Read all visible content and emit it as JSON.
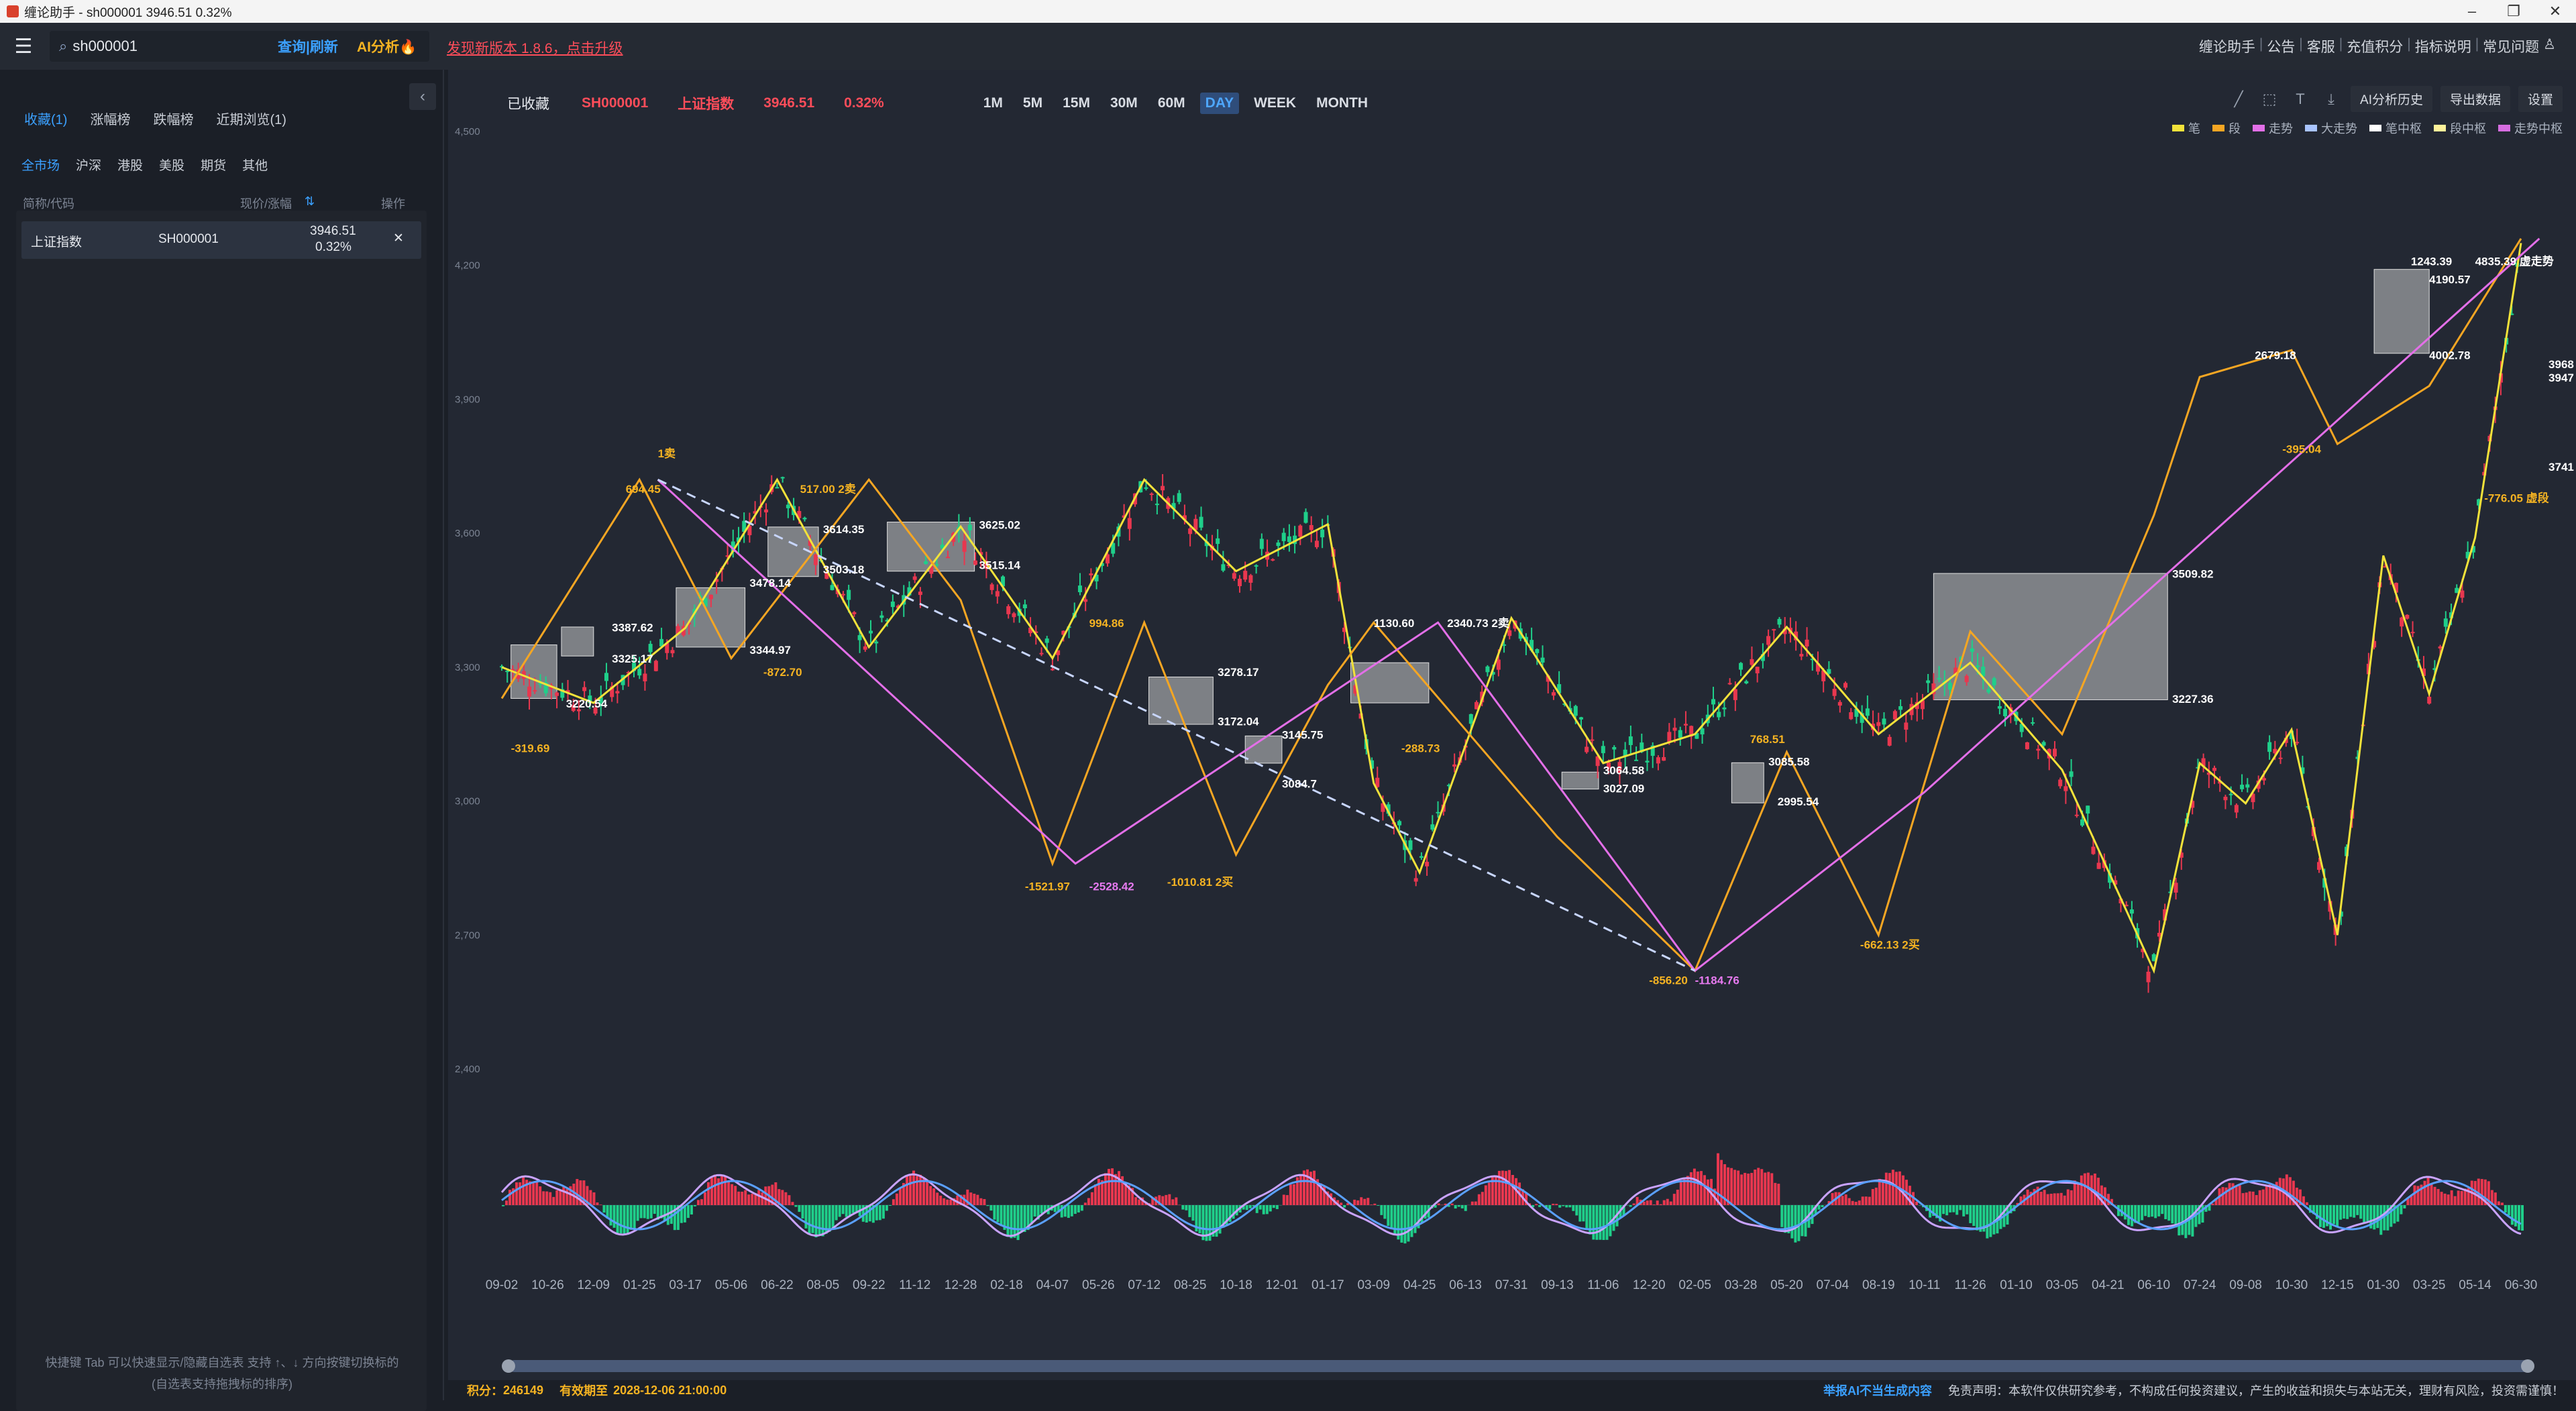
{
  "window": {
    "title": "缠论助手 - sh000001 3946.51 0.32%"
  },
  "topbar": {
    "search_value": "sh000001",
    "query_label": "查询|刷新",
    "ai_label": "AI分析🔥",
    "upgrade_text": "发现新版本 1.8.6，点击升级",
    "links": [
      "缠论助手",
      "公告",
      "客服",
      "充值积分",
      "指标说明",
      "常见问题"
    ]
  },
  "sidebar": {
    "tabs": [
      "收藏(1)",
      "涨幅榜",
      "跌幅榜",
      "近期浏览(1)"
    ],
    "markets": [
      "全市场",
      "沪深",
      "港股",
      "美股",
      "期货",
      "其他"
    ],
    "headers": {
      "name": "简称/代码",
      "price": "现价/涨幅",
      "action": "操作"
    },
    "rows": [
      {
        "name": "上证指数",
        "code": "SH000001",
        "price": "3946.51",
        "change": "0.32%"
      }
    ],
    "hint1": "快捷键 Tab 可以快速显示/隐藏自选表 支持 ↑、↓ 方向按键切换标的",
    "hint2": "(自选表支持拖拽标的排序)"
  },
  "chartbar": {
    "fav": "已收藏",
    "code": "SH000001",
    "name": "上证指数",
    "price": "3946.51",
    "pct": "0.32%"
  },
  "periods": [
    "1M",
    "5M",
    "15M",
    "30M",
    "60M",
    "DAY",
    "WEEK",
    "MONTH"
  ],
  "active_period": "DAY",
  "tools": {
    "ai_history": "AI分析历史",
    "export": "导出数据",
    "settings": "设置"
  },
  "legend": [
    {
      "label": "笔",
      "color": "#f2e23a"
    },
    {
      "label": "段",
      "color": "#f5a623"
    },
    {
      "label": "走势",
      "color": "#e36fe8"
    },
    {
      "label": "大走势",
      "color": "#a9c4ff"
    },
    {
      "label": "笔中枢",
      "color": "#ffffff"
    },
    {
      "label": "段中枢",
      "color": "#fff29a"
    },
    {
      "label": "走势中枢",
      "color": "#d66de0"
    }
  ],
  "status": {
    "points_label": "积分：",
    "points": "246149",
    "expiry_label": "有效期至",
    "expiry": "2028-12-06 21:00:00",
    "report": "举报AI不当生成内容",
    "disclaimer": "免责声明：本软件仅供研究参考，不构成任何投资建议，产生的收益和损失与本站无关，理财有风险，投资需谨慎！"
  },
  "chart_data": {
    "type": "line",
    "title": "",
    "y_ticks": [
      2400,
      2700,
      3000,
      3300,
      3600,
      3900,
      4200,
      4500
    ],
    "ylim": [
      2400,
      4500
    ],
    "x_labels": [
      "09-02",
      "10-26",
      "12-09",
      "01-25",
      "03-17",
      "05-06",
      "06-22",
      "08-05",
      "09-22",
      "11-12",
      "12-28",
      "02-18",
      "04-07",
      "05-26",
      "07-12",
      "08-25",
      "10-18",
      "12-01",
      "01-17",
      "03-09",
      "04-25",
      "06-13",
      "07-31",
      "09-13",
      "11-06",
      "12-20",
      "02-05",
      "03-28",
      "05-20",
      "07-04",
      "08-19",
      "10-11",
      "11-26",
      "01-10",
      "03-05",
      "04-21",
      "06-10",
      "07-24",
      "09-08",
      "10-30",
      "12-15",
      "01-30",
      "03-25",
      "05-14",
      "06-30"
    ],
    "series": [
      {
        "name": "笔",
        "x": [
          0,
          2,
          4,
          6,
          8,
          10,
          12,
          14,
          16,
          18,
          19,
          20,
          22,
          24,
          26,
          28,
          30,
          32,
          34,
          36,
          37,
          38,
          39,
          40,
          41,
          42,
          43,
          44
        ],
        "values": [
          3300,
          3220,
          3388,
          3720,
          3345,
          3615,
          3320,
          3720,
          3515,
          3620,
          3040,
          2840,
          3410,
          3085,
          3150,
          3390,
          3150,
          3310,
          3070,
          2620,
          3085,
          2995,
          3160,
          2700,
          3550,
          3240,
          3590,
          4250
        ]
      },
      {
        "name": "段",
        "x": [
          0,
          3,
          5,
          8,
          10,
          12,
          14,
          16,
          18,
          19,
          21,
          23,
          26,
          28,
          30,
          32,
          34,
          36,
          37,
          39,
          40,
          42,
          44
        ],
        "values": [
          3230,
          3720,
          3320,
          3720,
          3450,
          2860,
          3400,
          2880,
          3260,
          3400,
          3160,
          2920,
          2620,
          3110,
          2700,
          3380,
          3150,
          3640,
          3950,
          4010,
          3800,
          3930,
          4260
        ]
      },
      {
        "name": "走势",
        "x": [
          3.4,
          12.5,
          20.4,
          26.0,
          31.0,
          44.4
        ],
        "values": [
          3720,
          2860,
          3400,
          2620,
          3020,
          4260
        ]
      },
      {
        "name": "大走势",
        "x": [
          3.4,
          26.0
        ],
        "values": [
          3720,
          2620
        ]
      }
    ],
    "price_labels": [
      {
        "text": "694.45",
        "x": 2.7,
        "y": 3690
      },
      {
        "text": "1卖",
        "x": 3.4,
        "y": 3770
      },
      {
        "text": "-319.69",
        "x": 0.2,
        "y": 3110
      },
      {
        "text": "3220.54",
        "x": 1.4,
        "y": 3210
      },
      {
        "text": "3325.17",
        "x": 2.4,
        "y": 3310
      },
      {
        "text": "3387.62",
        "x": 2.4,
        "y": 3380
      },
      {
        "text": "3344.97",
        "x": 5.4,
        "y": 3330
      },
      {
        "text": "-872.70",
        "x": 5.7,
        "y": 3280
      },
      {
        "text": "3478.14",
        "x": 5.4,
        "y": 3480
      },
      {
        "text": "3614.35",
        "x": 7.0,
        "y": 3600
      },
      {
        "text": "3503.18",
        "x": 7.0,
        "y": 3510
      },
      {
        "text": "517.00 2卖",
        "x": 6.5,
        "y": 3690
      },
      {
        "text": "3625.02",
        "x": 10.4,
        "y": 3610
      },
      {
        "text": "3515.14",
        "x": 10.4,
        "y": 3520
      },
      {
        "text": "-1521.97",
        "x": 11.4,
        "y": 2800
      },
      {
        "text": "-2528.42",
        "x": 12.8,
        "y": 2800
      },
      {
        "text": "994.86",
        "x": 12.8,
        "y": 3390
      },
      {
        "text": "3278.17",
        "x": 15.6,
        "y": 3280
      },
      {
        "text": "3172.04",
        "x": 15.6,
        "y": 3170
      },
      {
        "text": "-1010.81 2买",
        "x": 14.5,
        "y": 2810
      },
      {
        "text": "3145.75",
        "x": 17.0,
        "y": 3140
      },
      {
        "text": "3084.7",
        "x": 17.0,
        "y": 3030
      },
      {
        "text": "1130.60",
        "x": 19.0,
        "y": 3390
      },
      {
        "text": "2340.73 2卖",
        "x": 20.6,
        "y": 3390
      },
      {
        "text": "-288.73",
        "x": 19.6,
        "y": 3110
      },
      {
        "text": "3064.58",
        "x": 24.0,
        "y": 3060
      },
      {
        "text": "3027.09",
        "x": 24.0,
        "y": 3020
      },
      {
        "text": "-856.20",
        "x": 25.0,
        "y": 2590
      },
      {
        "text": "-1184.76",
        "x": 26.0,
        "y": 2590
      },
      {
        "text": "768.51",
        "x": 27.2,
        "y": 3130
      },
      {
        "text": "3085.58",
        "x": 27.6,
        "y": 3080
      },
      {
        "text": "2995.54",
        "x": 27.8,
        "y": 2990
      },
      {
        "text": "-662.13 2买",
        "x": 29.6,
        "y": 2670
      },
      {
        "text": "3509.82",
        "x": 36.4,
        "y": 3500
      },
      {
        "text": "3227.36",
        "x": 36.4,
        "y": 3220
      },
      {
        "text": "2679.18",
        "x": 38.2,
        "y": 3990
      },
      {
        "text": "-395.04",
        "x": 38.8,
        "y": 3780
      },
      {
        "text": "1243.39",
        "x": 41.6,
        "y": 4200
      },
      {
        "text": "4835.39 虚走势",
        "x": 43.0,
        "y": 4200
      },
      {
        "text": "4190.57",
        "x": 42.0,
        "y": 4160
      },
      {
        "text": "4002.78",
        "x": 42.0,
        "y": 3990
      },
      {
        "text": "-776.05 虚段",
        "x": 43.2,
        "y": 3670
      },
      {
        "text": "3741",
        "x": 44.6,
        "y": 3740
      },
      {
        "text": "3947",
        "x": 44.6,
        "y": 3940
      },
      {
        "text": "3968",
        "x": 44.6,
        "y": 3970
      }
    ],
    "zones": [
      {
        "x0": 0.2,
        "x1": 1.2,
        "y0": 3230,
        "y1": 3350
      },
      {
        "x0": 1.3,
        "x1": 2.0,
        "y0": 3325,
        "y1": 3390
      },
      {
        "x0": 3.8,
        "x1": 5.3,
        "y0": 3345,
        "y1": 3478
      },
      {
        "x0": 5.8,
        "x1": 6.9,
        "y0": 3503,
        "y1": 3614
      },
      {
        "x0": 8.4,
        "x1": 10.3,
        "y0": 3515,
        "y1": 3625
      },
      {
        "x0": 14.1,
        "x1": 15.5,
        "y0": 3172,
        "y1": 3278
      },
      {
        "x0": 16.2,
        "x1": 17.0,
        "y0": 3085,
        "y1": 3146
      },
      {
        "x0": 18.5,
        "x1": 20.2,
        "y0": 3220,
        "y1": 3310
      },
      {
        "x0": 23.1,
        "x1": 23.9,
        "y0": 3027,
        "y1": 3065
      },
      {
        "x0": 26.8,
        "x1": 27.5,
        "y0": 2996,
        "y1": 3086
      },
      {
        "x0": 31.2,
        "x1": 36.3,
        "y0": 3227,
        "y1": 3510
      },
      {
        "x0": 40.8,
        "x1": 42.0,
        "y0": 4003,
        "y1": 4191
      }
    ]
  }
}
